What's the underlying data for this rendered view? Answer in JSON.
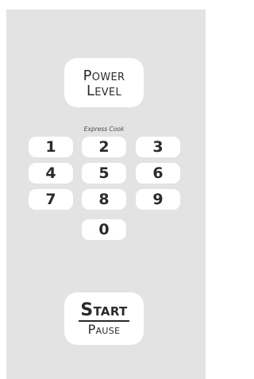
{
  "keypad": {
    "power_level": {
      "line1": "Power",
      "line2": "Level"
    },
    "express_cook_caption": "Express Cook",
    "keys": [
      "1",
      "2",
      "3",
      "4",
      "5",
      "6",
      "7",
      "8",
      "9",
      "0"
    ],
    "start_pause": {
      "line1": "Start",
      "line2": "Pause"
    }
  },
  "colors": {
    "panel": "#e3e3e3",
    "key": "#ffffff",
    "text": "#2b2b2b"
  }
}
